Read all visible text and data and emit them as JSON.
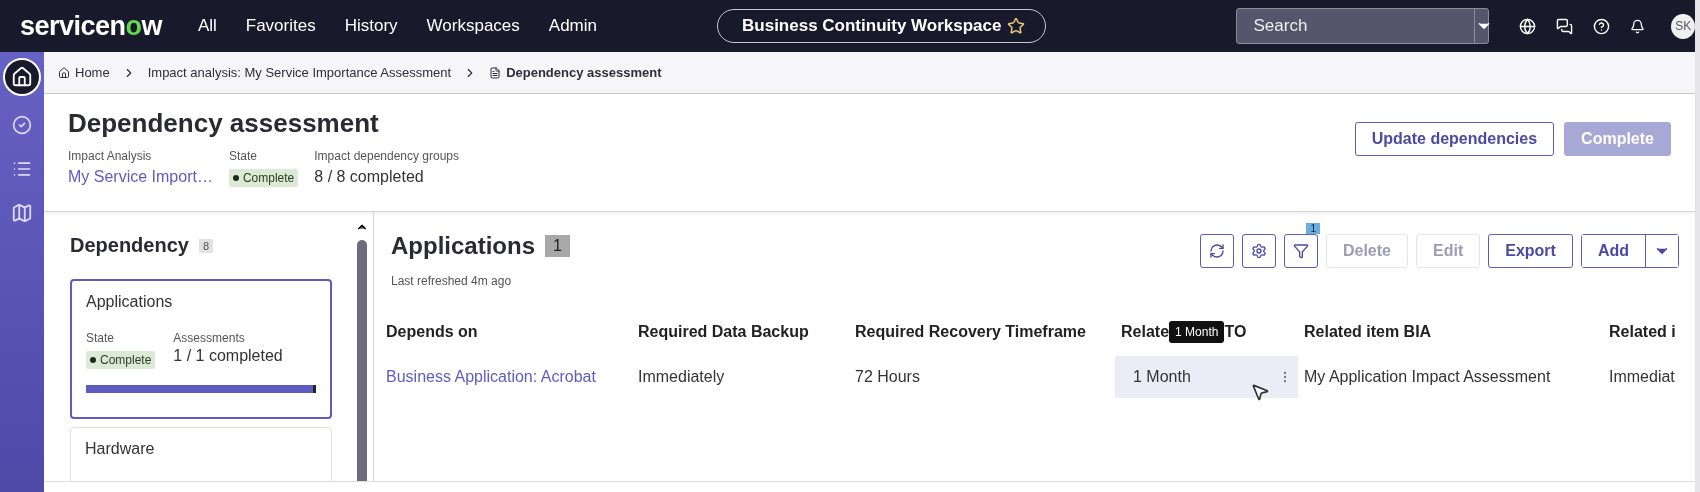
{
  "top_nav": {
    "logo_start": "servicen",
    "logo_o": "o",
    "logo_end": "w",
    "menu": [
      "All",
      "Favorites",
      "History",
      "Workspaces",
      "Admin"
    ],
    "workspace": "Business Continuity Workspace",
    "search": {
      "placeholder": "Search"
    },
    "avatar": "SK"
  },
  "rail": [
    {
      "kind": "home",
      "selected": true
    },
    {
      "kind": "check",
      "selected": false
    },
    {
      "kind": "list",
      "selected": false
    },
    {
      "kind": "map",
      "selected": false
    }
  ],
  "breadcrumbs": [
    {
      "label": "Home",
      "kind": "home"
    },
    {
      "label": "Impact analysis: My Service Importance Assessment",
      "kind": "link"
    },
    {
      "label": "Dependency assessment",
      "kind": "page"
    }
  ],
  "header": {
    "title": "Dependency assessment",
    "fields": [
      {
        "label": "Impact Analysis",
        "value": "My Service Import…",
        "kind": "link"
      },
      {
        "label": "State",
        "value": "Complete",
        "kind": "status"
      },
      {
        "label": "Impact dependency groups",
        "value": "8 / 8 completed",
        "kind": "text"
      }
    ],
    "buttons": [
      {
        "label": "Update dependencies",
        "disabled": false
      },
      {
        "label": "Complete",
        "disabled": true
      }
    ]
  },
  "dependency": {
    "title": "Dependency",
    "count": "8",
    "cards": [
      {
        "title": "Applications",
        "selected": true,
        "state_label": "State",
        "state": "Complete",
        "assessments_label": "Assessments",
        "assessments": "1 / 1 completed",
        "level": 1
      },
      {
        "title": "Hardware",
        "selected": false
      }
    ]
  },
  "applications": {
    "title": "Applications",
    "count": "1",
    "refreshed": "Last refreshed 4m ago",
    "toolbar": [
      {
        "kind": "refresh"
      },
      {
        "kind": "settings"
      },
      {
        "kind": "filter",
        "badge": "1"
      },
      {
        "kind": "text",
        "label": "Delete",
        "disabled": true
      },
      {
        "kind": "text",
        "label": "Edit",
        "disabled": true
      },
      {
        "kind": "text",
        "label": "Export",
        "disabled": false
      },
      {
        "kind": "split",
        "label": "Add"
      }
    ],
    "columns": [
      {
        "label": "Depends on"
      },
      {
        "label": "Required Data Backup"
      },
      {
        "label": "Required Recovery Timeframe"
      },
      {
        "label": "Relate",
        "label_after": "TO",
        "tooltip": "1 Month"
      },
      {
        "label": "Related item BIA"
      },
      {
        "label": "Related i"
      }
    ],
    "rows": [
      {
        "cells": [
          {
            "text": "Business Application: Acrobat",
            "kind": "link",
            "hovered": false
          },
          {
            "text": "Immediately",
            "kind": "text",
            "hovered": false
          },
          {
            "text": "72 Hours",
            "kind": "text",
            "hovered": false
          },
          {
            "text": "1 Month",
            "kind": "text",
            "hovered": true
          },
          {
            "text": "My Application Impact Assessment",
            "kind": "text",
            "hovered": false
          },
          {
            "text": "Immediat",
            "kind": "text",
            "hovered": false
          }
        ]
      }
    ]
  }
}
